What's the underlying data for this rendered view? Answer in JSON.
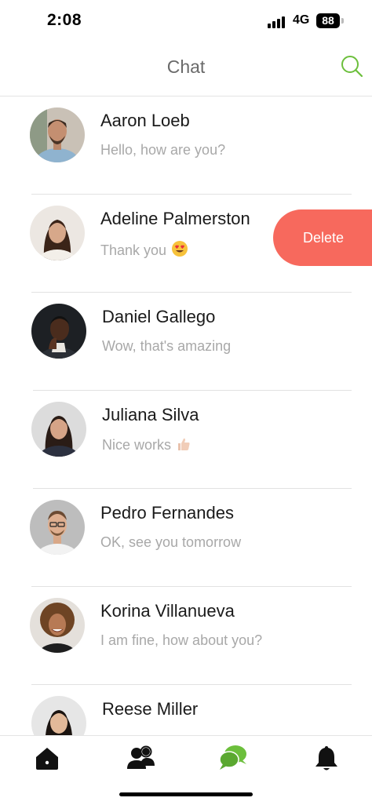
{
  "status": {
    "time": "2:08",
    "network": "4G",
    "battery": "88"
  },
  "header": {
    "title": "Chat"
  },
  "chats": [
    {
      "name": "Aaron Loeb",
      "message": "Hello, how are you?"
    },
    {
      "name": "Adeline Palmerston",
      "message": "Thank you",
      "emoji": "heart-eyes-emoji"
    },
    {
      "name": "Daniel Gallego",
      "message": "Wow, that's amazing"
    },
    {
      "name": "Juliana Silva",
      "message": "Nice works",
      "emoji": "thumbs-up-emoji"
    },
    {
      "name": "Pedro Fernandes",
      "message": "OK, see you tomorrow"
    },
    {
      "name": "Korina Villanueva",
      "message": "I am fine, how about you?"
    },
    {
      "name": "Reese Miller",
      "message": ""
    }
  ],
  "swipe_action": {
    "label": "Delete"
  },
  "tabs": [
    "home-icon",
    "users-icon",
    "chat-icon",
    "bell-icon"
  ],
  "colors": {
    "accent": "#6cbf3c",
    "delete": "#f7695d"
  }
}
